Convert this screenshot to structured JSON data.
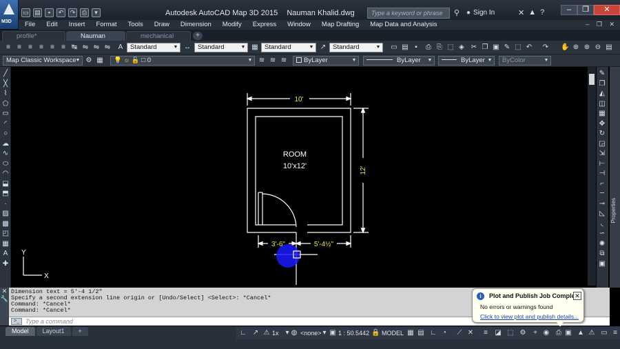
{
  "app": {
    "logo_label": "M3D",
    "title": "Autodesk AutoCAD Map 3D 2015",
    "filename": "Nauman Khalid.dwg"
  },
  "search": {
    "placeholder": "Type a keyword or phrase"
  },
  "account": {
    "sign_in": "Sign In"
  },
  "menu": [
    "File",
    "Edit",
    "Insert",
    "Format",
    "Tools",
    "Draw",
    "Dimension",
    "Modify",
    "Express",
    "Window",
    "Map Drafting",
    "Map Data and Analysis"
  ],
  "tabs": [
    {
      "label": "profile*",
      "active": false
    },
    {
      "label": "Nauman Khalid*",
      "active": true
    },
    {
      "label": "mechanical fitting-8",
      "active": false
    }
  ],
  "styles_toolbar": {
    "text_style": "Standard",
    "dim_style": "Standard",
    "table_style": "Standard",
    "mleader_style": "Standard"
  },
  "properties_toolbar": {
    "workspace": "Map Classic Workspace",
    "layer": "0",
    "color": "ByLayer",
    "linetype": "ByLayer",
    "lineweight": "ByLayer",
    "plotstyle": "ByColor"
  },
  "drawing": {
    "room_label": "ROOM",
    "room_size": "10'x12'",
    "dim_width": "10'",
    "dim_height": "12'",
    "dim_left": "3'-6\"",
    "dim_right": "5'-4½\"",
    "ucs_x": "X",
    "ucs_y": "Y"
  },
  "command_history": [
    "Dimension text = 5'-4 1/2\"",
    "Specify a second extension line origin or [Undo/Select] <Select>: *Cancel*",
    "Command: *Cancel*",
    "Command: *Cancel*"
  ],
  "command_input": {
    "placeholder": "Type a command"
  },
  "layout_tabs": [
    "Model",
    "Layout1"
  ],
  "status": {
    "scale_x": "1x",
    "annotation": "<none>",
    "map_scale": "1 : 50.5442",
    "space": "MODEL"
  },
  "notification": {
    "title": "Plot and Publish Job Complete",
    "message": "No errors or warnings found",
    "link": "Click to view plot and publish details..."
  },
  "side_panel": {
    "label": "Properties"
  },
  "colors": {
    "drawing_lines": "#ffffff",
    "dimension": "#ffffff",
    "dim_text_yellow": "#e8e84a",
    "grip_blue": "#1a1aff",
    "link": "#1a3fb6"
  }
}
